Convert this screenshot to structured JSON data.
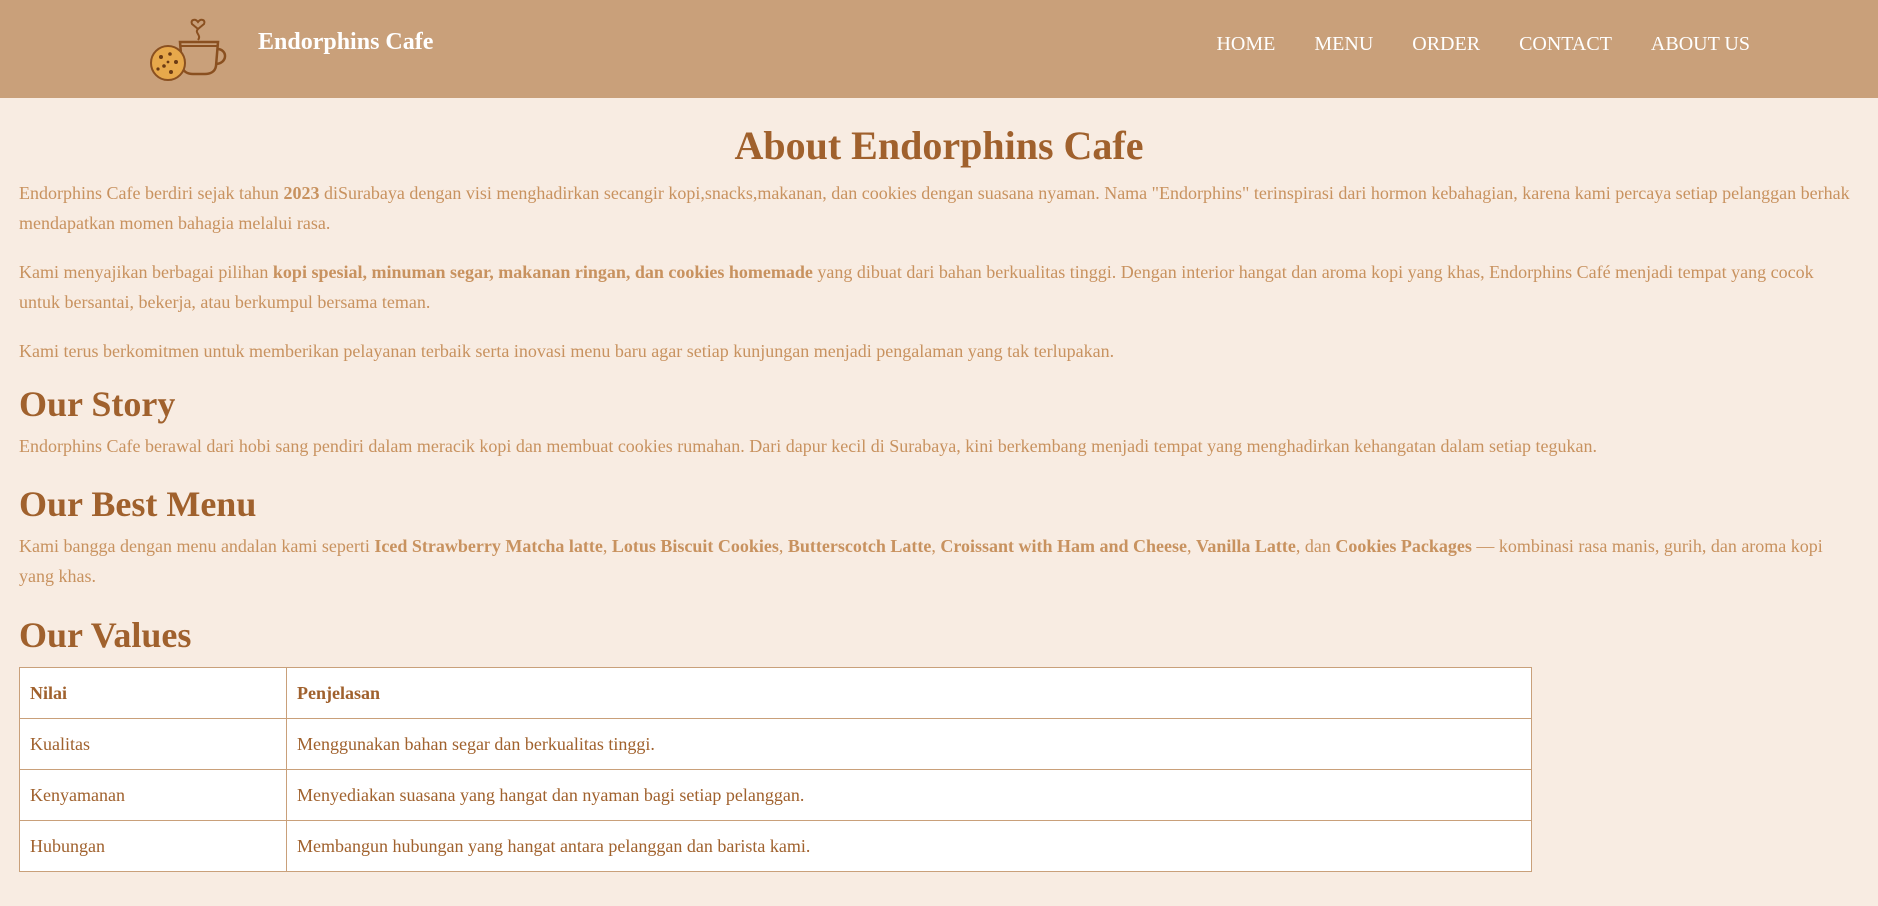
{
  "header": {
    "brand": "Endorphins Cafe",
    "logo_icon": "coffee-cup-and-cookie-icon",
    "nav": [
      "HOME",
      "MENU",
      "ORDER",
      "CONTACT",
      "ABOUT US"
    ]
  },
  "colors": {
    "header_bg": "#c9a07a",
    "page_bg": "#f8ece2",
    "heading": "#a0612d",
    "text": "#c8925f"
  },
  "about": {
    "title": "About Endorphins Cafe",
    "p1": {
      "a": "Endorphins Cafe berdiri sejak tahun ",
      "b": "2023",
      "c": " diSurabaya dengan visi menghadirkan secangir kopi,snacks,makanan, dan cookies dengan suasana nyaman. Nama \"Endorphins\" terinspirasi dari hormon kebahagian, karena kami percaya setiap pelanggan berhak mendapatkan momen bahagia melalui rasa."
    },
    "p2": {
      "a": "Kami menyajikan berbagai pilihan ",
      "b": "kopi spesial, minuman segar, makanan ringan, dan cookies homemade",
      "c": " yang dibuat dari bahan berkualitas tinggi. Dengan interior hangat dan aroma kopi yang khas, Endorphins Café menjadi tempat yang cocok untuk bersantai, bekerja, atau berkumpul bersama teman."
    },
    "p3": "Kami terus berkomitmen untuk memberikan pelayanan terbaik serta inovasi menu baru agar setiap kunjungan menjadi pengalaman yang tak terlupakan."
  },
  "story": {
    "title": "Our Story",
    "text": "Endorphins Cafe berawal dari hobi sang pendiri dalam meracik kopi dan membuat cookies rumahan. Dari dapur kecil di Surabaya, kini berkembang menjadi tempat yang menghadirkan kehangatan dalam setiap tegukan."
  },
  "best_menu": {
    "title": "Our Best Menu",
    "intro": "Kami bangga dengan menu andalan kami seperti ",
    "items": [
      "Iced Strawberry Matcha latte",
      "Lotus Biscuit Cookies",
      "Butterscotch Latte",
      "Croissant with Ham and Cheese",
      "Vanilla Latte",
      "Cookies Packages"
    ],
    "sep": ", ",
    "and": ", dan ",
    "outro": " — kombinasi rasa manis, gurih, dan aroma kopi yang khas."
  },
  "values": {
    "title": "Our Values",
    "headers": [
      "Nilai",
      "Penjelasan"
    ],
    "rows": [
      [
        "Kualitas",
        "Menggunakan bahan segar dan berkualitas tinggi."
      ],
      [
        "Kenyamanan",
        "Menyediakan suasana yang hangat dan nyaman bagi setiap pelanggan."
      ],
      [
        "Hubungan",
        "Membangun hubungan yang hangat antara pelanggan dan barista kami."
      ]
    ]
  }
}
